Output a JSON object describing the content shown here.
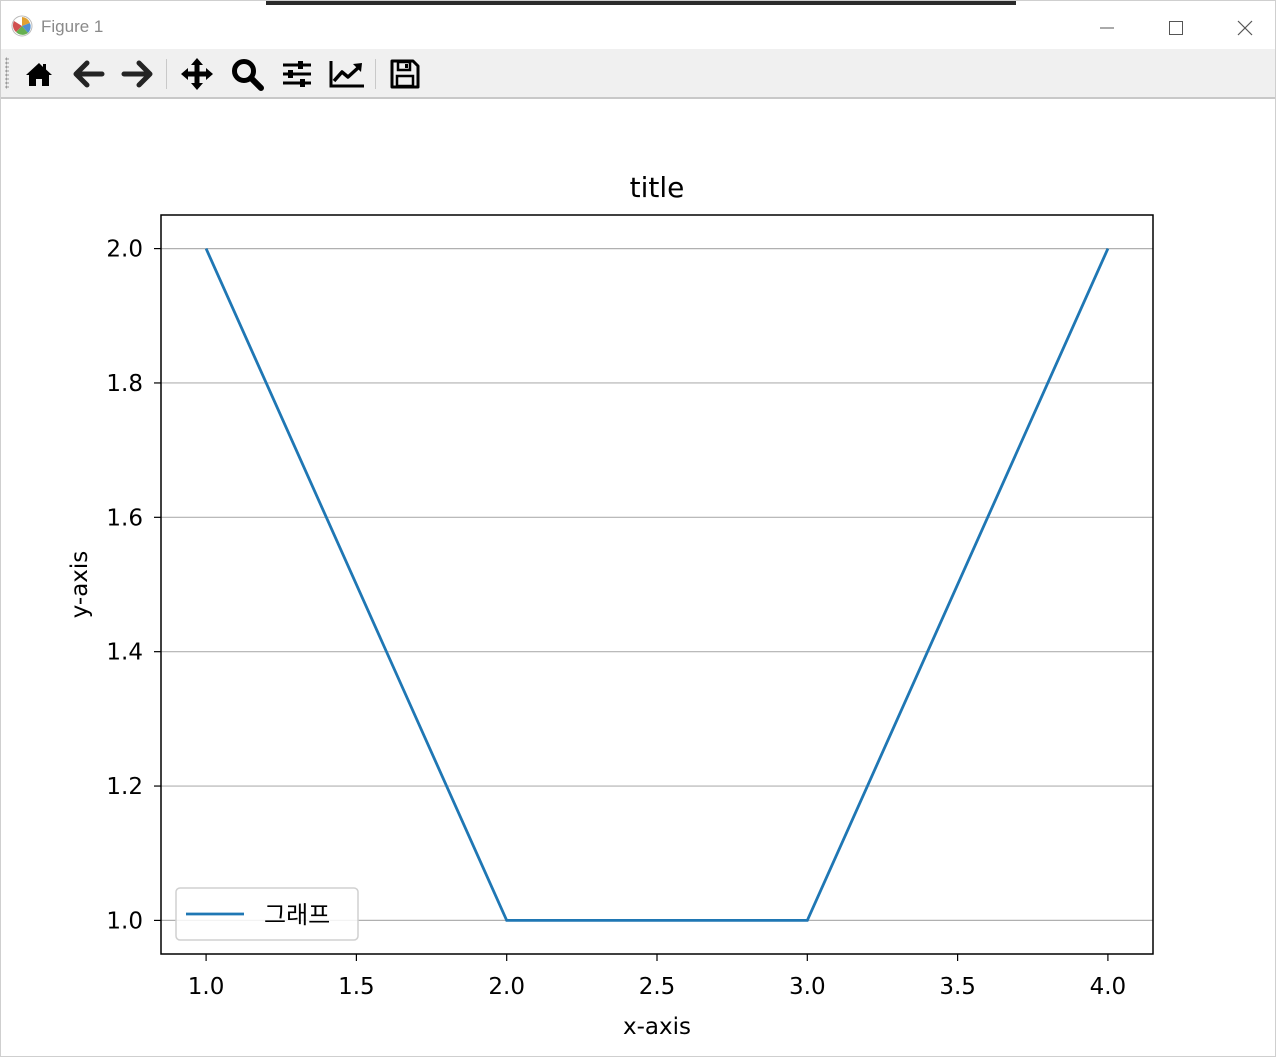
{
  "window": {
    "title": "Figure 1"
  },
  "toolbar": {
    "buttons": [
      {
        "name": "home-icon",
        "label": "Home"
      },
      {
        "name": "back-icon",
        "label": "Back"
      },
      {
        "name": "forward-icon",
        "label": "Forward"
      },
      {
        "name": "pan-icon",
        "label": "Pan"
      },
      {
        "name": "zoom-icon",
        "label": "Zoom"
      },
      {
        "name": "subplots-icon",
        "label": "Subplots"
      },
      {
        "name": "customize-icon",
        "label": "Customize"
      },
      {
        "name": "save-icon",
        "label": "Save"
      }
    ]
  },
  "chart_data": {
    "type": "line",
    "title": "title",
    "xlabel": "x-axis",
    "ylabel": "y-axis",
    "x": [
      1.0,
      2.0,
      3.0,
      4.0
    ],
    "series": [
      {
        "name": "그래프",
        "values": [
          2.0,
          1.0,
          1.0,
          2.0
        ],
        "color": "#1f77b4"
      }
    ],
    "xlim": [
      0.85,
      4.15
    ],
    "ylim": [
      0.95,
      2.05
    ],
    "xticks": [
      "1.0",
      "1.5",
      "2.0",
      "2.5",
      "3.0",
      "3.5",
      "4.0"
    ],
    "yticks": [
      "1.0",
      "1.2",
      "1.4",
      "1.6",
      "1.8",
      "2.0"
    ],
    "grid": "y-axis only",
    "legend": "lower left"
  }
}
